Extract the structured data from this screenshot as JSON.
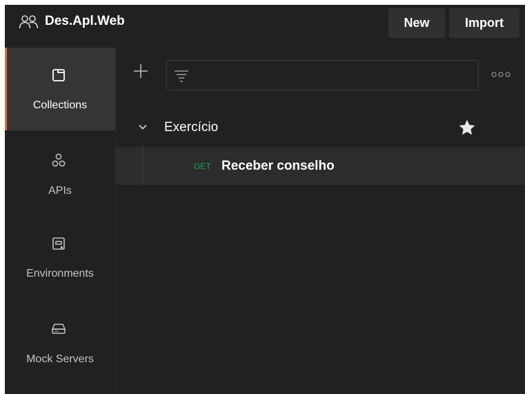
{
  "header": {
    "workspace_icon": "people-icon",
    "workspace_name": "Des.Apl.Web",
    "new_label": "New",
    "import_label": "Import"
  },
  "nav": {
    "items": [
      {
        "label": "Collections",
        "icon": "collections-icon",
        "active": true
      },
      {
        "label": "APIs",
        "icon": "apis-icon",
        "active": false
      },
      {
        "label": "Environments",
        "icon": "environments-icon",
        "active": false
      },
      {
        "label": "Mock Servers",
        "icon": "mock-servers-icon",
        "active": false
      }
    ]
  },
  "toolbar": {
    "add_icon": "plus-icon",
    "filter_icon": "filter-icon",
    "search_value": "",
    "more_icon": "more-icon"
  },
  "collections": [
    {
      "name": "Exercício",
      "expanded": true,
      "starred": true,
      "requests": [
        {
          "method": "GET",
          "name": "Receber conselho"
        }
      ]
    }
  ],
  "colors": {
    "background": "#212121",
    "active_nav_bg": "#353535",
    "accent": "#f26b3a",
    "method_get": "#1fa151",
    "selected_row": "#2c2c2c",
    "text": "#ffffff",
    "muted_text": "#c4c4c4"
  }
}
